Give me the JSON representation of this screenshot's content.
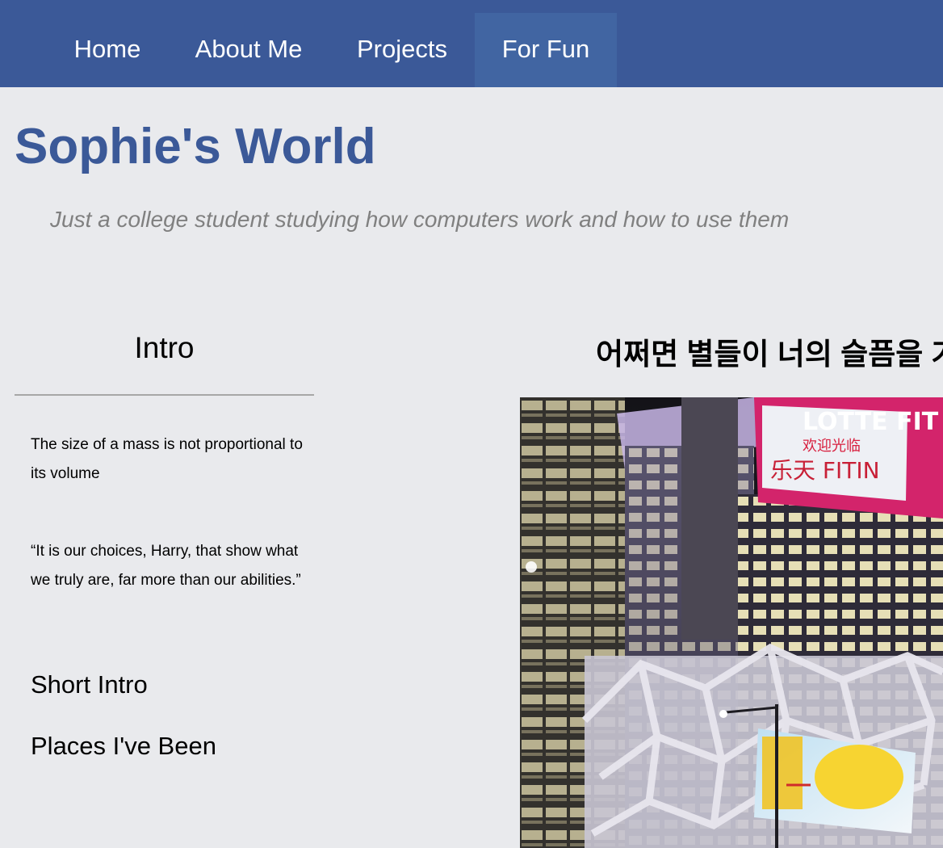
{
  "nav": {
    "items": [
      {
        "label": "Home",
        "active": false
      },
      {
        "label": "About Me",
        "active": false
      },
      {
        "label": "Projects",
        "active": false
      },
      {
        "label": "For Fun",
        "active": true
      }
    ]
  },
  "header": {
    "title": "Sophie's World",
    "tagline": "Just a college student studying how computers work and how to use them"
  },
  "sidebar": {
    "title": "Intro",
    "fact": "The size of a mass is not proportional to its volume",
    "quote": "“It is our choices, Harry, that show what we truly are, far more than our abilities.”",
    "links": [
      "Short Intro",
      "Places I've Been"
    ]
  },
  "main": {
    "heading": "어쩌면 별들이 너의 슬픔을 가",
    "photo": {
      "sign_lines": [
        "LOTTE FIT",
        "欢迎光临",
        "乐天 FITIN"
      ]
    }
  },
  "colors": {
    "nav_bg": "#3b5998",
    "nav_active": "#4165a2",
    "title": "#3b5998",
    "page_bg": "#e9eaed",
    "tagline": "#808080"
  }
}
